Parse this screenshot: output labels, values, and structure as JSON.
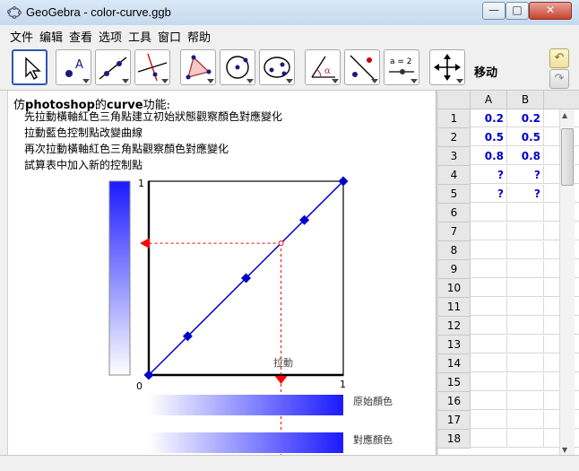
{
  "window": {
    "title": "GeoGebra - color-curve.ggb"
  },
  "titlebar_buttons": {
    "minimize": "—",
    "maximize": "□",
    "close": "✕"
  },
  "menu": [
    "文件",
    "编辑",
    "查看",
    "选项",
    "工具",
    "窗口",
    "帮助"
  ],
  "toolbar": {
    "active_tool_name": "移动",
    "tool_icons": [
      "move-icon",
      "point-icon",
      "line-icon",
      "perpendicular-line-icon",
      "polygon-icon",
      "circle-icon",
      "ellipse-icon",
      "angle-icon",
      "reflect-icon",
      "slider-icon",
      "move-view-icon"
    ],
    "slider_tool_label": "a = 2",
    "undo": "↶",
    "redo": "↷"
  },
  "graphics": {
    "title_prefix": "仿",
    "title_bold1": "photoshop",
    "title_mid": "的",
    "title_bold2": "curve",
    "title_suffix": "功能:",
    "instructions": [
      "先拉動橫軸紅色三角點建立初始狀態觀察顏色對應變化",
      "拉動藍色控制點改變曲線",
      "再次拉動橫軸紅色三角點觀察顏色對應變化",
      "試算表中加入新的控制點"
    ],
    "axis_top_label": "1",
    "axis_origin_label": "0",
    "axis_right_label": "1",
    "drag_label": "拉動",
    "original_color_label": "原始顏色",
    "mapped_color_label": "對應顏色",
    "colors": {
      "curve": "#0000cc",
      "guide": "#ff0000",
      "gradient_end": "#1a1aff"
    }
  },
  "spreadsheet": {
    "columns": [
      "A",
      "B"
    ],
    "rows": [
      "1",
      "2",
      "3",
      "4",
      "5",
      "6",
      "7",
      "8",
      "9",
      "10",
      "11",
      "12",
      "13",
      "14",
      "15",
      "16",
      "17",
      "18"
    ],
    "cells": [
      [
        "0.2",
        "0.2"
      ],
      [
        "0.5",
        "0.5"
      ],
      [
        "0.8",
        "0.8"
      ],
      [
        "?",
        "?"
      ],
      [
        "?",
        "?"
      ]
    ]
  },
  "chart_data": {
    "type": "line",
    "title": "",
    "xlim": [
      0,
      1
    ],
    "ylim": [
      0,
      1
    ],
    "series": [
      {
        "points": [
          [
            0,
            0
          ],
          [
            0.2,
            0.2
          ],
          [
            0.5,
            0.5
          ],
          [
            0.8,
            0.8
          ],
          [
            1,
            1
          ]
        ]
      }
    ],
    "drag_point_x": 0.68,
    "drag_point_y": 0.68
  }
}
